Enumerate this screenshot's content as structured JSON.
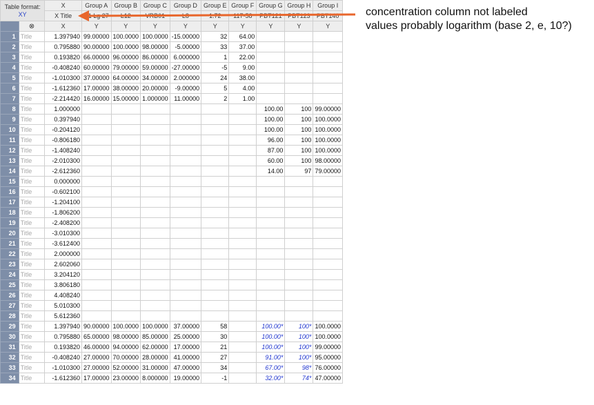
{
  "corner": {
    "label": "Table format:",
    "format": "XY"
  },
  "headers": {
    "x": "X",
    "groups": [
      "Group A",
      "Group B",
      "Group C",
      "Group D",
      "Group E",
      "Group F",
      "Group G",
      "Group H",
      "Group I"
    ],
    "x_title_placeholder": "X Title",
    "subtitles": [
      "A1 Lg 27",
      "L12",
      "VRB01",
      "L8",
      "1.72",
      "117-58",
      "PBT121",
      "PBT123",
      "PBT140"
    ],
    "x_col": "X",
    "y_col": "Y",
    "clear_icon": "⊗"
  },
  "row_title_placeholder": "Title",
  "rows": [
    {
      "n": "1",
      "x": "1.397940",
      "v": [
        "99.00000",
        "100.0000",
        "100.0000",
        "-15.00000",
        "32",
        "64.00",
        "",
        "",
        ""
      ]
    },
    {
      "n": "2",
      "x": "0.795880",
      "v": [
        "90.00000",
        "100.0000",
        "98.00000",
        "-5.00000",
        "33",
        "37.00",
        "",
        "",
        ""
      ]
    },
    {
      "n": "3",
      "x": "0.193820",
      "v": [
        "66.00000",
        "96.00000",
        "86.00000",
        "6.000000",
        "1",
        "22.00",
        "",
        "",
        ""
      ]
    },
    {
      "n": "4",
      "x": "-0.408240",
      "v": [
        "60.00000",
        "79.00000",
        "59.00000",
        "-27.00000",
        "-5",
        "9.00",
        "",
        "",
        ""
      ]
    },
    {
      "n": "5",
      "x": "-1.010300",
      "v": [
        "37.00000",
        "64.00000",
        "34.00000",
        "2.000000",
        "24",
        "38.00",
        "",
        "",
        ""
      ]
    },
    {
      "n": "6",
      "x": "-1.612360",
      "v": [
        "17.00000",
        "38.00000",
        "20.00000",
        "-9.00000",
        "5",
        "4.00",
        "",
        "",
        ""
      ]
    },
    {
      "n": "7",
      "x": "-2.214420",
      "v": [
        "16.00000",
        "15.00000",
        "1.000000",
        "11.00000",
        "2",
        "1.00",
        "",
        "",
        ""
      ]
    },
    {
      "n": "8",
      "x": "1.000000",
      "v": [
        "",
        "",
        "",
        "",
        "",
        "",
        "100.00",
        "100",
        "99.00000"
      ]
    },
    {
      "n": "9",
      "x": "0.397940",
      "v": [
        "",
        "",
        "",
        "",
        "",
        "",
        "100.00",
        "100",
        "100.0000"
      ]
    },
    {
      "n": "10",
      "x": "-0.204120",
      "v": [
        "",
        "",
        "",
        "",
        "",
        "",
        "100.00",
        "100",
        "100.0000"
      ]
    },
    {
      "n": "11",
      "x": "-0.806180",
      "v": [
        "",
        "",
        "",
        "",
        "",
        "",
        "96.00",
        "100",
        "100.0000"
      ]
    },
    {
      "n": "12",
      "x": "-1.408240",
      "v": [
        "",
        "",
        "",
        "",
        "",
        "",
        "87.00",
        "100",
        "100.0000"
      ]
    },
    {
      "n": "13",
      "x": "-2.010300",
      "v": [
        "",
        "",
        "",
        "",
        "",
        "",
        "60.00",
        "100",
        "98.00000"
      ]
    },
    {
      "n": "14",
      "x": "-2.612360",
      "v": [
        "",
        "",
        "",
        "",
        "",
        "",
        "14.00",
        "97",
        "79.00000"
      ]
    },
    {
      "n": "15",
      "x": "0.000000",
      "v": [
        "",
        "",
        "",
        "",
        "",
        "",
        "",
        "",
        ""
      ]
    },
    {
      "n": "16",
      "x": "-0.602100",
      "v": [
        "",
        "",
        "",
        "",
        "",
        "",
        "",
        "",
        ""
      ]
    },
    {
      "n": "17",
      "x": "-1.204100",
      "v": [
        "",
        "",
        "",
        "",
        "",
        "",
        "",
        "",
        ""
      ]
    },
    {
      "n": "18",
      "x": "-1.806200",
      "v": [
        "",
        "",
        "",
        "",
        "",
        "",
        "",
        "",
        ""
      ]
    },
    {
      "n": "19",
      "x": "-2.408200",
      "v": [
        "",
        "",
        "",
        "",
        "",
        "",
        "",
        "",
        ""
      ]
    },
    {
      "n": "20",
      "x": "-3.010300",
      "v": [
        "",
        "",
        "",
        "",
        "",
        "",
        "",
        "",
        ""
      ]
    },
    {
      "n": "21",
      "x": "-3.612400",
      "v": [
        "",
        "",
        "",
        "",
        "",
        "",
        "",
        "",
        ""
      ]
    },
    {
      "n": "22",
      "x": "2.000000",
      "v": [
        "",
        "",
        "",
        "",
        "",
        "",
        "",
        "",
        ""
      ]
    },
    {
      "n": "23",
      "x": "2.602060",
      "v": [
        "",
        "",
        "",
        "",
        "",
        "",
        "",
        "",
        ""
      ]
    },
    {
      "n": "24",
      "x": "3.204120",
      "v": [
        "",
        "",
        "",
        "",
        "",
        "",
        "",
        "",
        ""
      ]
    },
    {
      "n": "25",
      "x": "3.806180",
      "v": [
        "",
        "",
        "",
        "",
        "",
        "",
        "",
        "",
        ""
      ]
    },
    {
      "n": "26",
      "x": "4.408240",
      "v": [
        "",
        "",
        "",
        "",
        "",
        "",
        "",
        "",
        ""
      ]
    },
    {
      "n": "27",
      "x": "5.010300",
      "v": [
        "",
        "",
        "",
        "",
        "",
        "",
        "",
        "",
        ""
      ]
    },
    {
      "n": "28",
      "x": "5.612360",
      "v": [
        "",
        "",
        "",
        "",
        "",
        "",
        "",
        "",
        ""
      ]
    },
    {
      "n": "29",
      "x": "1.397940",
      "v": [
        "90.00000",
        "100.0000",
        "100.0000",
        "37.00000",
        "58",
        "",
        "100.00*",
        "100*",
        "100.0000"
      ]
    },
    {
      "n": "30",
      "x": "0.795880",
      "v": [
        "65.00000",
        "98.00000",
        "85.00000",
        "25.00000",
        "30",
        "",
        "100.00*",
        "100*",
        "100.0000"
      ]
    },
    {
      "n": "31",
      "x": "0.193820",
      "v": [
        "46.00000",
        "94.00000",
        "62.00000",
        "17.00000",
        "21",
        "",
        "100.00*",
        "100*",
        "99.00000"
      ]
    },
    {
      "n": "32",
      "x": "-0.408240",
      "v": [
        "27.00000",
        "70.00000",
        "28.00000",
        "41.00000",
        "27",
        "",
        "91.00*",
        "100*",
        "95.00000"
      ]
    },
    {
      "n": "33",
      "x": "-1.010300",
      "v": [
        "27.00000",
        "52.00000",
        "31.00000",
        "47.00000",
        "34",
        "",
        "67.00*",
        "98*",
        "76.00000"
      ]
    },
    {
      "n": "34",
      "x": "-1.612360",
      "v": [
        "17.00000",
        "23.00000",
        "8.000000",
        "19.00000",
        "-1",
        "",
        "32.00*",
        "74*",
        "47.00000"
      ]
    }
  ],
  "annotation": {
    "line1": "concentration column not labeled",
    "line2": "values probably logarithm (base 2, e, 10?)",
    "arrow_color": "#e8662c"
  }
}
